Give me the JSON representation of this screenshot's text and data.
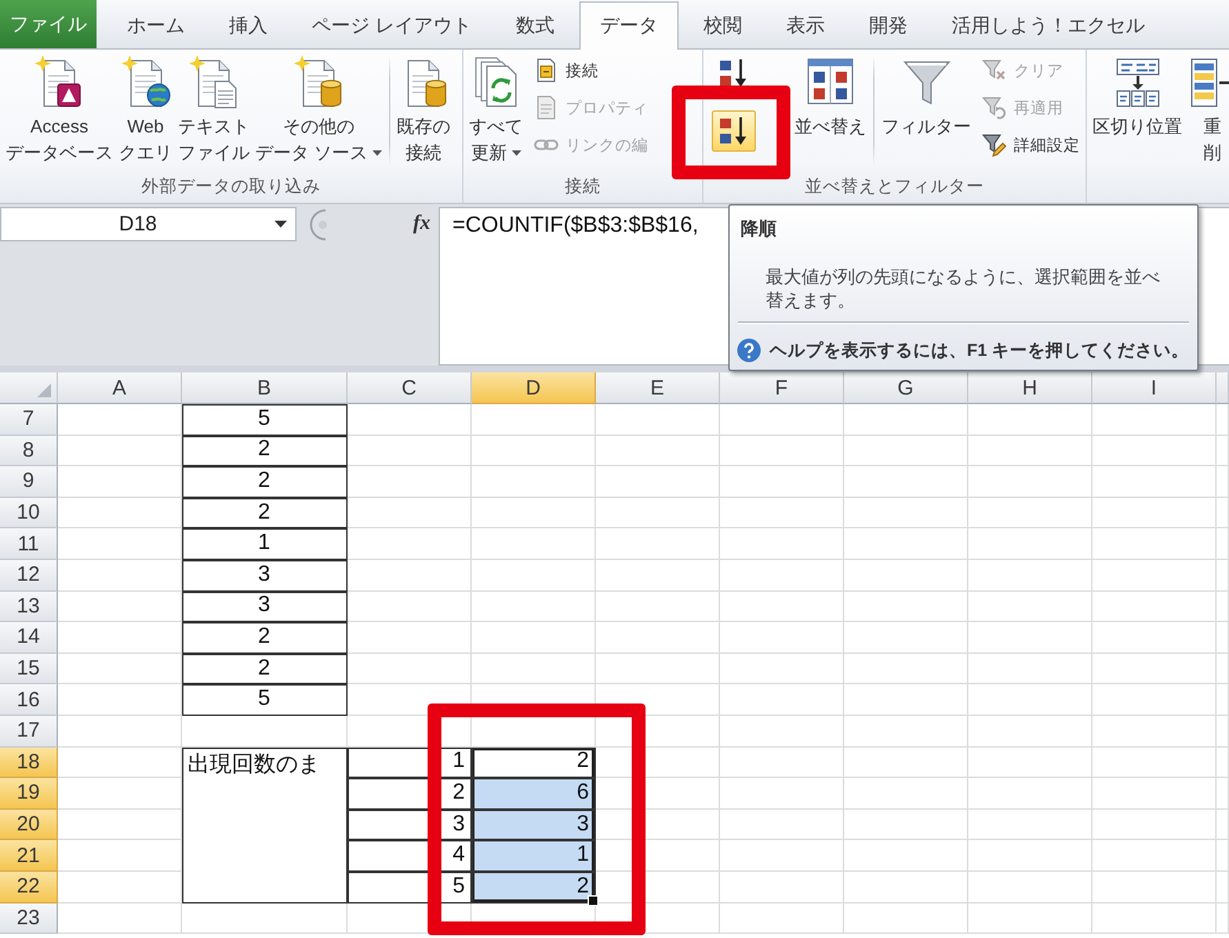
{
  "ribbon_tabs": [
    {
      "label": "ファイル",
      "kind": "file",
      "selected": false
    },
    {
      "label": "ホーム",
      "kind": "tab",
      "selected": false
    },
    {
      "label": "挿入",
      "kind": "tab",
      "selected": false
    },
    {
      "label": "ページ レイアウト",
      "kind": "tab",
      "selected": false
    },
    {
      "label": "数式",
      "kind": "tab",
      "selected": false
    },
    {
      "label": "データ",
      "kind": "tab",
      "selected": true
    },
    {
      "label": "校閲",
      "kind": "tab",
      "selected": false
    },
    {
      "label": "表示",
      "kind": "tab",
      "selected": false
    },
    {
      "label": "開発",
      "kind": "tab",
      "selected": false
    },
    {
      "label": "活用しよう！エクセル",
      "kind": "tab",
      "selected": false
    }
  ],
  "ribbon_groups": [
    {
      "label": "外部データの取り込み",
      "items": [
        {
          "kind": "large",
          "lines": [
            "Access",
            "データベース"
          ],
          "dropdown": false,
          "disabled": false,
          "hovered": false
        },
        {
          "kind": "large",
          "lines": [
            "Web",
            "クエリ"
          ],
          "dropdown": false,
          "disabled": false,
          "hovered": false
        },
        {
          "kind": "large",
          "lines": [
            "テキスト",
            "ファイル"
          ],
          "dropdown": false,
          "disabled": false,
          "hovered": false
        },
        {
          "kind": "large",
          "lines": [
            "その他の",
            "データ ソース"
          ],
          "dropdown": true,
          "disabled": false,
          "hovered": false
        },
        {
          "kind": "separator"
        },
        {
          "kind": "large",
          "lines": [
            "既存の",
            "接続"
          ],
          "dropdown": false,
          "disabled": false,
          "hovered": false
        }
      ]
    },
    {
      "label": "接続",
      "items": [
        {
          "kind": "large",
          "lines": [
            "すべて",
            "更新"
          ],
          "dropdown": true,
          "disabled": false,
          "hovered": false
        },
        {
          "kind": "small",
          "label": "接続",
          "disabled": false,
          "hovered": false
        },
        {
          "kind": "small",
          "label": "プロパティ",
          "disabled": true,
          "hovered": false
        },
        {
          "kind": "small",
          "label": "リンクの編",
          "disabled": true,
          "hovered": false
        }
      ]
    },
    {
      "label": "並べ替えとフィルター",
      "items": [
        {
          "kind": "icon_small",
          "disabled": false,
          "hovered": false
        },
        {
          "kind": "icon_small",
          "disabled": false,
          "hovered": true
        },
        {
          "kind": "large",
          "lines": [
            "並べ替え"
          ],
          "dropdown": false,
          "disabled": false,
          "hovered": false
        },
        {
          "kind": "separator"
        },
        {
          "kind": "large",
          "lines": [
            "フィルター"
          ],
          "dropdown": false,
          "disabled": false,
          "hovered": false
        },
        {
          "kind": "small",
          "label": "クリア",
          "disabled": true,
          "hovered": false
        },
        {
          "kind": "small",
          "label": "再適用",
          "disabled": true,
          "hovered": false
        },
        {
          "kind": "small",
          "label": "詳細設定",
          "disabled": false,
          "hovered": false
        }
      ]
    },
    {
      "items": [
        {
          "kind": "large",
          "lines": [
            "区切り位置"
          ],
          "dropdown": false,
          "disabled": false,
          "hovered": false
        },
        {
          "kind": "large",
          "lines": [
            "重",
            "削"
          ],
          "dropdown": false,
          "disabled": false,
          "hovered": false
        }
      ]
    }
  ],
  "formula_bar": {
    "name_box": "D18",
    "function_button": "fx",
    "formula": "=COUNTIF($B$3:$B$16,"
  },
  "tooltip": {
    "title": "降順",
    "description": "最大値が列の先頭になるように、選択範囲を並べ替えます。",
    "help": "ヘルプを表示するには、F1 キーを押してください。"
  },
  "sheet": {
    "columns": [
      {
        "label": "A",
        "selected": false
      },
      {
        "label": "B",
        "selected": false
      },
      {
        "label": "C",
        "selected": false
      },
      {
        "label": "D",
        "selected": true
      },
      {
        "label": "E",
        "selected": false
      },
      {
        "label": "F",
        "selected": false
      },
      {
        "label": "G",
        "selected": false
      },
      {
        "label": "H",
        "selected": false
      },
      {
        "label": "I",
        "selected": false
      }
    ],
    "rows": [
      {
        "number": "7",
        "selected": false,
        "cells": {
          "b": {
            "value": "5",
            "kind": "number",
            "centered": true,
            "bordered": true,
            "selected": false,
            "active": false
          }
        }
      },
      {
        "number": "8",
        "selected": false,
        "cells": {
          "b": {
            "value": "2",
            "kind": "number",
            "centered": true,
            "bordered": true,
            "selected": false,
            "active": false
          }
        }
      },
      {
        "number": "9",
        "selected": false,
        "cells": {
          "b": {
            "value": "2",
            "kind": "number",
            "centered": true,
            "bordered": true,
            "selected": false,
            "active": false
          }
        }
      },
      {
        "number": "10",
        "selected": false,
        "cells": {
          "b": {
            "value": "2",
            "kind": "number",
            "centered": true,
            "bordered": true,
            "selected": false,
            "active": false
          }
        }
      },
      {
        "number": "11",
        "selected": false,
        "cells": {
          "b": {
            "value": "1",
            "kind": "number",
            "centered": true,
            "bordered": true,
            "selected": false,
            "active": false
          }
        }
      },
      {
        "number": "12",
        "selected": false,
        "cells": {
          "b": {
            "value": "3",
            "kind": "number",
            "centered": true,
            "bordered": true,
            "selected": false,
            "active": false
          }
        }
      },
      {
        "number": "13",
        "selected": false,
        "cells": {
          "b": {
            "value": "3",
            "kind": "number",
            "centered": true,
            "bordered": true,
            "selected": false,
            "active": false
          }
        }
      },
      {
        "number": "14",
        "selected": false,
        "cells": {
          "b": {
            "value": "2",
            "kind": "number",
            "centered": true,
            "bordered": true,
            "selected": false,
            "active": false
          }
        }
      },
      {
        "number": "15",
        "selected": false,
        "cells": {
          "b": {
            "value": "2",
            "kind": "number",
            "centered": true,
            "bordered": true,
            "selected": false,
            "active": false
          }
        }
      },
      {
        "number": "16",
        "selected": false,
        "cells": {
          "b": {
            "value": "5",
            "kind": "number",
            "centered": true,
            "bordered": true,
            "selected": false,
            "active": false
          }
        }
      },
      {
        "number": "17",
        "selected": false
      },
      {
        "number": "18",
        "selected": true,
        "cells": {
          "b": {
            "value": "出現回数のま",
            "kind": "text",
            "centered": false,
            "bordered": true,
            "selected": false,
            "active": false
          },
          "c": {
            "value": "1",
            "kind": "number",
            "centered": false,
            "bordered": true,
            "selected": false,
            "active": false
          },
          "d": {
            "value": "2",
            "kind": "number",
            "centered": false,
            "bordered": true,
            "selected": true,
            "active": true
          }
        }
      },
      {
        "number": "19",
        "selected": true,
        "cells": {
          "b": {
            "kind": "merged"
          },
          "c": {
            "value": "2",
            "kind": "number",
            "centered": false,
            "bordered": true,
            "selected": false,
            "active": false
          },
          "d": {
            "value": "6",
            "kind": "number",
            "centered": false,
            "bordered": true,
            "selected": true,
            "active": false
          }
        }
      },
      {
        "number": "20",
        "selected": true,
        "cells": {
          "b": {
            "kind": "merged"
          },
          "c": {
            "value": "3",
            "kind": "number",
            "centered": false,
            "bordered": true,
            "selected": false,
            "active": false
          },
          "d": {
            "value": "3",
            "kind": "number",
            "centered": false,
            "bordered": true,
            "selected": true,
            "active": false
          }
        }
      },
      {
        "number": "21",
        "selected": true,
        "cells": {
          "b": {
            "kind": "merged"
          },
          "c": {
            "value": "4",
            "kind": "number",
            "centered": false,
            "bordered": true,
            "selected": false,
            "active": false
          },
          "d": {
            "value": "1",
            "kind": "number",
            "centered": false,
            "bordered": true,
            "selected": true,
            "active": false
          }
        }
      },
      {
        "number": "22",
        "selected": true,
        "cells": {
          "b": {
            "kind": "merged"
          },
          "c": {
            "value": "5",
            "kind": "number",
            "centered": false,
            "bordered": true,
            "selected": false,
            "active": false
          },
          "d": {
            "value": "2",
            "kind": "number",
            "centered": false,
            "bordered": true,
            "selected": true,
            "active": false
          }
        }
      },
      {
        "number": "23",
        "selected": false
      }
    ]
  },
  "annotations": [
    {
      "kind": "frame"
    },
    {
      "kind": "frame"
    }
  ]
}
